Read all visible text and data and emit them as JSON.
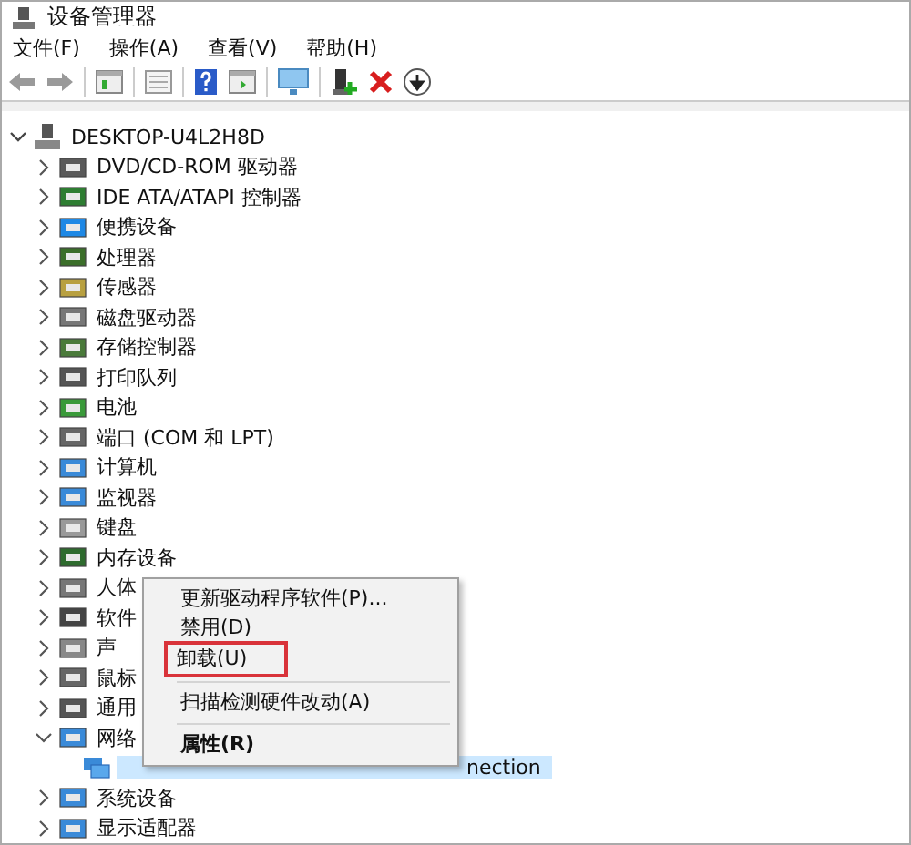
{
  "window": {
    "title": "设备管理器"
  },
  "menu_bar": [
    "文件(F)",
    "操作(A)",
    "查看(V)",
    "帮助(H)"
  ],
  "tree": {
    "label": "DESKTOP-U4L2H8D",
    "expanded": true,
    "selected": false,
    "children": [
      {
        "label": "DVD/CD-ROM 驱动器",
        "expanded": false,
        "selected": false
      },
      {
        "label": "IDE ATA/ATAPI 控制器",
        "expanded": false,
        "selected": false
      },
      {
        "label": "便携设备",
        "expanded": false,
        "selected": false
      },
      {
        "label": "处理器",
        "expanded": false,
        "selected": false
      },
      {
        "label": "传感器",
        "expanded": false,
        "selected": false
      },
      {
        "label": "磁盘驱动器",
        "expanded": false,
        "selected": false
      },
      {
        "label": "存储控制器",
        "expanded": false,
        "selected": false
      },
      {
        "label": "打印队列",
        "expanded": false,
        "selected": false
      },
      {
        "label": "电池",
        "expanded": false,
        "selected": false
      },
      {
        "label": "端口 (COM 和 LPT)",
        "expanded": false,
        "selected": false
      },
      {
        "label": "计算机",
        "expanded": false,
        "selected": false
      },
      {
        "label": "监视器",
        "expanded": false,
        "selected": false
      },
      {
        "label": "键盘",
        "expanded": false,
        "selected": false
      },
      {
        "label": "内存设备",
        "expanded": false,
        "selected": false
      },
      {
        "label": "人体",
        "expanded": false,
        "selected": false
      },
      {
        "label": "软件",
        "expanded": false,
        "selected": false
      },
      {
        "label": "声",
        "expanded": false,
        "selected": false
      },
      {
        "label": "鼠标",
        "expanded": false,
        "selected": false
      },
      {
        "label": "通用",
        "expanded": false,
        "selected": false
      },
      {
        "label": "网络",
        "expanded": true,
        "selected": false,
        "children": [
          {
            "label": "nection",
            "selected": true
          }
        ]
      },
      {
        "label": "系统设备",
        "expanded": false,
        "selected": false
      },
      {
        "label": "显示适配器",
        "expanded": false,
        "selected": false
      }
    ]
  },
  "context_menu": [
    {
      "kind": "item",
      "label": "更新驱动程序软件(P)...",
      "boxed": false,
      "default": false
    },
    {
      "kind": "item",
      "label": "禁用(D)",
      "boxed": false,
      "default": false
    },
    {
      "kind": "item",
      "label": "卸载(U)",
      "boxed": true,
      "default": false
    },
    {
      "kind": "separator"
    },
    {
      "kind": "item",
      "label": "扫描检测硬件改动(A)",
      "boxed": false,
      "default": false
    },
    {
      "kind": "separator"
    },
    {
      "kind": "item",
      "label": "属性(R)",
      "boxed": false,
      "default": true
    }
  ]
}
